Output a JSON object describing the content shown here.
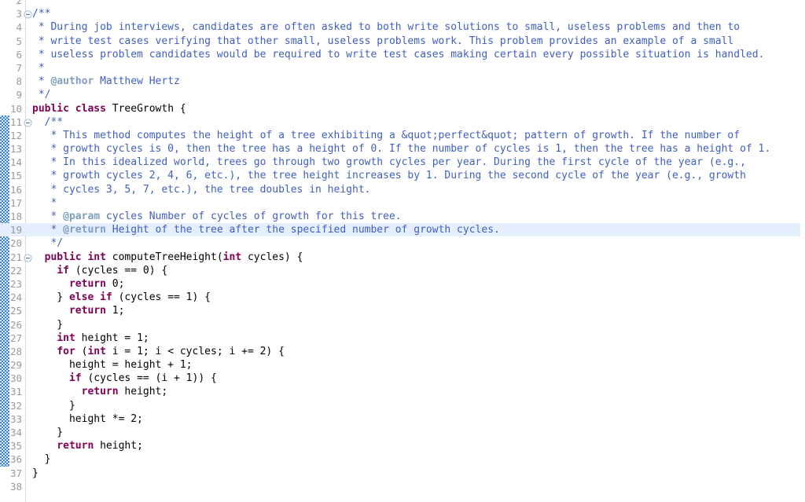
{
  "editor": {
    "app": "eclipse-java-editor",
    "language": "java",
    "font_size_px": 13,
    "line_height_px": 17.2,
    "first_visible_line": 2,
    "last_visible_line": 38,
    "current_line": 19,
    "colors": {
      "background": "#ffffff",
      "current_line_highlight": "#e4eefc",
      "line_number": "#999999",
      "keyword": "#7f0055",
      "javadoc_comment": "#3f5fbf",
      "javadoc_tag": "#7f9fbf",
      "identifier": "#000000",
      "change_bar": "#3a7fc4",
      "gutter_separator": "#d8d8d8"
    },
    "change_bar_range": {
      "from_line": 11,
      "to_line": 36
    },
    "folding_markers": [
      3,
      11,
      21
    ]
  },
  "lines": [
    {
      "n": 2,
      "fold": false,
      "change": false,
      "current": false,
      "tokens": []
    },
    {
      "n": 3,
      "fold": true,
      "change": false,
      "current": false,
      "tokens": [
        {
          "t": "cmt",
          "s": "/**"
        }
      ]
    },
    {
      "n": 4,
      "fold": false,
      "change": false,
      "current": false,
      "tokens": [
        {
          "t": "cmt",
          "s": " * During job interviews, candidates are often asked to both write solutions to small, useless problems and then to"
        }
      ]
    },
    {
      "n": 5,
      "fold": false,
      "change": false,
      "current": false,
      "tokens": [
        {
          "t": "cmt",
          "s": " * write test cases verifying that other small, useless problems work. This problem provides an example of a small"
        }
      ]
    },
    {
      "n": 6,
      "fold": false,
      "change": false,
      "current": false,
      "tokens": [
        {
          "t": "cmt",
          "s": " * useless problem candidates would be required to write test cases making certain every possible situation is handled."
        }
      ]
    },
    {
      "n": 7,
      "fold": false,
      "change": false,
      "current": false,
      "tokens": [
        {
          "t": "cmt",
          "s": " *"
        }
      ]
    },
    {
      "n": 8,
      "fold": false,
      "change": false,
      "current": false,
      "tokens": [
        {
          "t": "cmt",
          "s": " * "
        },
        {
          "t": "ctag",
          "s": "@author"
        },
        {
          "t": "cmt",
          "s": " Matthew Hertz"
        }
      ]
    },
    {
      "n": 9,
      "fold": false,
      "change": false,
      "current": false,
      "tokens": [
        {
          "t": "cmt",
          "s": " */"
        }
      ]
    },
    {
      "n": 10,
      "fold": false,
      "change": false,
      "current": false,
      "tokens": [
        {
          "t": "kw",
          "s": "public"
        },
        {
          "t": "pln",
          "s": " "
        },
        {
          "t": "kw",
          "s": "class"
        },
        {
          "t": "pln",
          "s": " TreeGrowth {"
        }
      ]
    },
    {
      "n": 11,
      "fold": true,
      "change": true,
      "current": false,
      "tokens": [
        {
          "t": "cmt",
          "s": "  /**"
        }
      ]
    },
    {
      "n": 12,
      "fold": false,
      "change": true,
      "current": false,
      "tokens": [
        {
          "t": "cmt",
          "s": "   * This method computes the height of a tree exhibiting a &quot;perfect&quot; pattern of growth. If the number of"
        }
      ]
    },
    {
      "n": 13,
      "fold": false,
      "change": true,
      "current": false,
      "tokens": [
        {
          "t": "cmt",
          "s": "   * growth cycles is 0, then the tree has a height of 0. If the number of cycles is 1, then the tree has a height of 1."
        }
      ]
    },
    {
      "n": 14,
      "fold": false,
      "change": true,
      "current": false,
      "tokens": [
        {
          "t": "cmt",
          "s": "   * In this idealized world, trees go through two growth cycles per year. During the first cycle of the year (e.g.,"
        }
      ]
    },
    {
      "n": 15,
      "fold": false,
      "change": true,
      "current": false,
      "tokens": [
        {
          "t": "cmt",
          "s": "   * growth cycles 2, 4, 6, etc.), the tree height increases by 1. During the second cycle of the year (e.g., growth"
        }
      ]
    },
    {
      "n": 16,
      "fold": false,
      "change": true,
      "current": false,
      "tokens": [
        {
          "t": "cmt",
          "s": "   * cycles 3, 5, 7, etc.), the tree doubles in height."
        }
      ]
    },
    {
      "n": 17,
      "fold": false,
      "change": true,
      "current": false,
      "tokens": [
        {
          "t": "cmt",
          "s": "   *"
        }
      ]
    },
    {
      "n": 18,
      "fold": false,
      "change": true,
      "current": false,
      "tokens": [
        {
          "t": "cmt",
          "s": "   * "
        },
        {
          "t": "ctag",
          "s": "@param"
        },
        {
          "t": "cmt",
          "s": " cycles Number of cycles of growth for this tree."
        }
      ]
    },
    {
      "n": 19,
      "fold": false,
      "change": true,
      "current": true,
      "tokens": [
        {
          "t": "cmt",
          "s": "   * "
        },
        {
          "t": "ctag",
          "s": "@return"
        },
        {
          "t": "cmt",
          "s": " Height of the tree after the specified number of growth cycles."
        }
      ]
    },
    {
      "n": 20,
      "fold": false,
      "change": true,
      "current": false,
      "tokens": [
        {
          "t": "cmt",
          "s": "   */"
        }
      ]
    },
    {
      "n": 21,
      "fold": true,
      "change": true,
      "current": false,
      "tokens": [
        {
          "t": "pln",
          "s": "  "
        },
        {
          "t": "kw",
          "s": "public"
        },
        {
          "t": "pln",
          "s": " "
        },
        {
          "t": "kw",
          "s": "int"
        },
        {
          "t": "pln",
          "s": " computeTreeHeight("
        },
        {
          "t": "kw",
          "s": "int"
        },
        {
          "t": "pln",
          "s": " cycles) {"
        }
      ]
    },
    {
      "n": 22,
      "fold": false,
      "change": true,
      "current": false,
      "tokens": [
        {
          "t": "pln",
          "s": "    "
        },
        {
          "t": "kw",
          "s": "if"
        },
        {
          "t": "pln",
          "s": " (cycles == 0) {"
        }
      ]
    },
    {
      "n": 23,
      "fold": false,
      "change": true,
      "current": false,
      "tokens": [
        {
          "t": "pln",
          "s": "      "
        },
        {
          "t": "kw",
          "s": "return"
        },
        {
          "t": "pln",
          "s": " 0;"
        }
      ]
    },
    {
      "n": 24,
      "fold": false,
      "change": true,
      "current": false,
      "tokens": [
        {
          "t": "pln",
          "s": "    } "
        },
        {
          "t": "kw",
          "s": "else"
        },
        {
          "t": "pln",
          "s": " "
        },
        {
          "t": "kw",
          "s": "if"
        },
        {
          "t": "pln",
          "s": " (cycles == 1) {"
        }
      ]
    },
    {
      "n": 25,
      "fold": false,
      "change": true,
      "current": false,
      "tokens": [
        {
          "t": "pln",
          "s": "      "
        },
        {
          "t": "kw",
          "s": "return"
        },
        {
          "t": "pln",
          "s": " 1;"
        }
      ]
    },
    {
      "n": 26,
      "fold": false,
      "change": true,
      "current": false,
      "tokens": [
        {
          "t": "pln",
          "s": "    }"
        }
      ]
    },
    {
      "n": 27,
      "fold": false,
      "change": true,
      "current": false,
      "tokens": [
        {
          "t": "pln",
          "s": "    "
        },
        {
          "t": "kw",
          "s": "int"
        },
        {
          "t": "pln",
          "s": " height = 1;"
        }
      ]
    },
    {
      "n": 28,
      "fold": false,
      "change": true,
      "current": false,
      "tokens": [
        {
          "t": "pln",
          "s": "    "
        },
        {
          "t": "kw",
          "s": "for"
        },
        {
          "t": "pln",
          "s": " ("
        },
        {
          "t": "kw",
          "s": "int"
        },
        {
          "t": "pln",
          "s": " i = 1; i < cycles; i += 2) {"
        }
      ]
    },
    {
      "n": 29,
      "fold": false,
      "change": true,
      "current": false,
      "tokens": [
        {
          "t": "pln",
          "s": "      height = height + 1;"
        }
      ]
    },
    {
      "n": 30,
      "fold": false,
      "change": true,
      "current": false,
      "tokens": [
        {
          "t": "pln",
          "s": "      "
        },
        {
          "t": "kw",
          "s": "if"
        },
        {
          "t": "pln",
          "s": " (cycles == (i + 1)) {"
        }
      ]
    },
    {
      "n": 31,
      "fold": false,
      "change": true,
      "current": false,
      "tokens": [
        {
          "t": "pln",
          "s": "        "
        },
        {
          "t": "kw",
          "s": "return"
        },
        {
          "t": "pln",
          "s": " height;"
        }
      ]
    },
    {
      "n": 32,
      "fold": false,
      "change": true,
      "current": false,
      "tokens": [
        {
          "t": "pln",
          "s": "      }"
        }
      ]
    },
    {
      "n": 33,
      "fold": false,
      "change": true,
      "current": false,
      "tokens": [
        {
          "t": "pln",
          "s": "      height *= 2;"
        }
      ]
    },
    {
      "n": 34,
      "fold": false,
      "change": true,
      "current": false,
      "tokens": [
        {
          "t": "pln",
          "s": "    }"
        }
      ]
    },
    {
      "n": 35,
      "fold": false,
      "change": true,
      "current": false,
      "tokens": [
        {
          "t": "pln",
          "s": "    "
        },
        {
          "t": "kw",
          "s": "return"
        },
        {
          "t": "pln",
          "s": " height;"
        }
      ]
    },
    {
      "n": 36,
      "fold": false,
      "change": true,
      "current": false,
      "tokens": [
        {
          "t": "pln",
          "s": "  }"
        }
      ]
    },
    {
      "n": 37,
      "fold": false,
      "change": false,
      "current": false,
      "tokens": [
        {
          "t": "pln",
          "s": "}"
        }
      ]
    },
    {
      "n": 38,
      "fold": false,
      "change": false,
      "current": false,
      "tokens": []
    }
  ]
}
